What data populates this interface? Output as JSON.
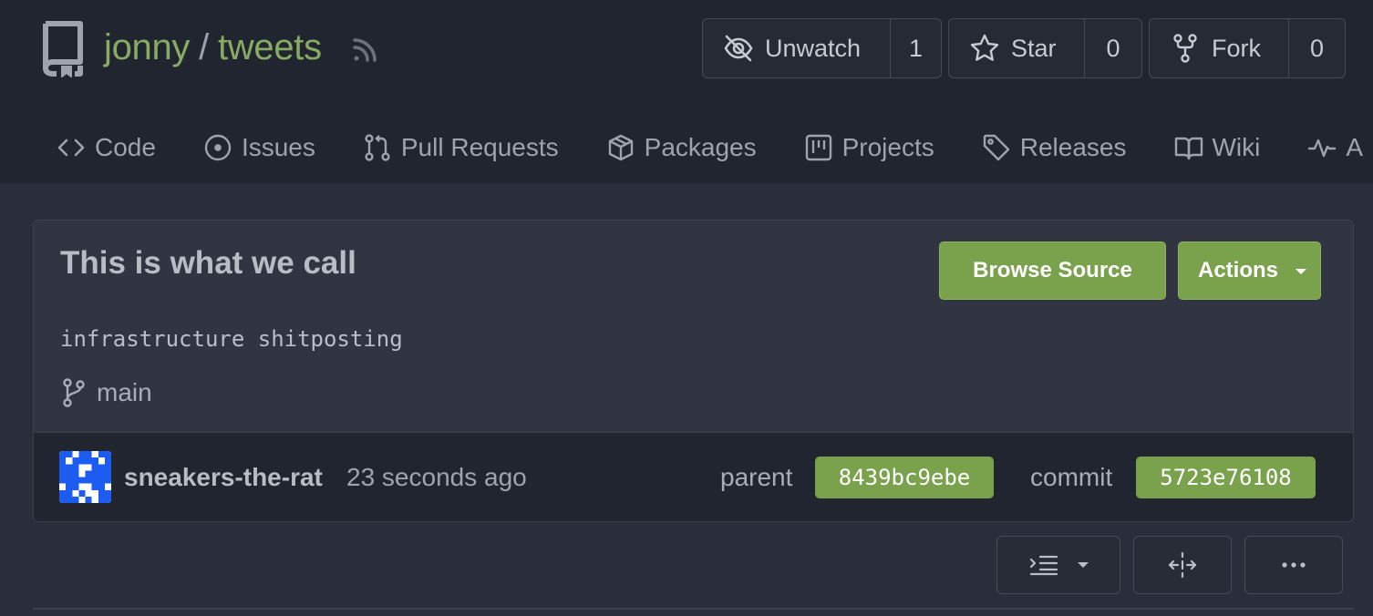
{
  "repo": {
    "owner": "jonny",
    "separator": "/",
    "name": "tweets",
    "icon": "repo-icon",
    "feed_icon": "rss-icon"
  },
  "actions": {
    "watch": {
      "label": "Unwatch",
      "count": "1",
      "icon": "eye-slash-icon"
    },
    "star": {
      "label": "Star",
      "count": "0",
      "icon": "star-icon"
    },
    "fork": {
      "label": "Fork",
      "count": "0",
      "icon": "fork-icon"
    }
  },
  "tabs": [
    {
      "label": "Code",
      "icon": "code-icon"
    },
    {
      "label": "Issues",
      "icon": "issue-icon"
    },
    {
      "label": "Pull Requests",
      "icon": "pull-request-icon"
    },
    {
      "label": "Packages",
      "icon": "package-icon"
    },
    {
      "label": "Projects",
      "icon": "project-icon"
    },
    {
      "label": "Releases",
      "icon": "tag-icon"
    },
    {
      "label": "Wiki",
      "icon": "book-icon"
    },
    {
      "label": "A",
      "icon": "pulse-icon"
    }
  ],
  "commit": {
    "title": "This is what we call",
    "description": "infrastructure shitposting",
    "branch": "main",
    "browse_source_label": "Browse Source",
    "actions_label": "Actions",
    "author": "sneakers-the-rat",
    "time": "23 seconds ago",
    "parent_label": "parent",
    "parent_sha": "8439bc9ebe",
    "commit_label": "commit",
    "commit_sha": "5723e76108"
  },
  "toolbar": {
    "whitespace_icon": "indent-icon",
    "expand_icon": "expand-icon",
    "more_icon": "kebab-horizontal-icon"
  },
  "colors": {
    "accent_green": "#7aa24d",
    "link_green": "#87ab63",
    "background": "#2a2e3a",
    "header_background": "#21252f"
  }
}
